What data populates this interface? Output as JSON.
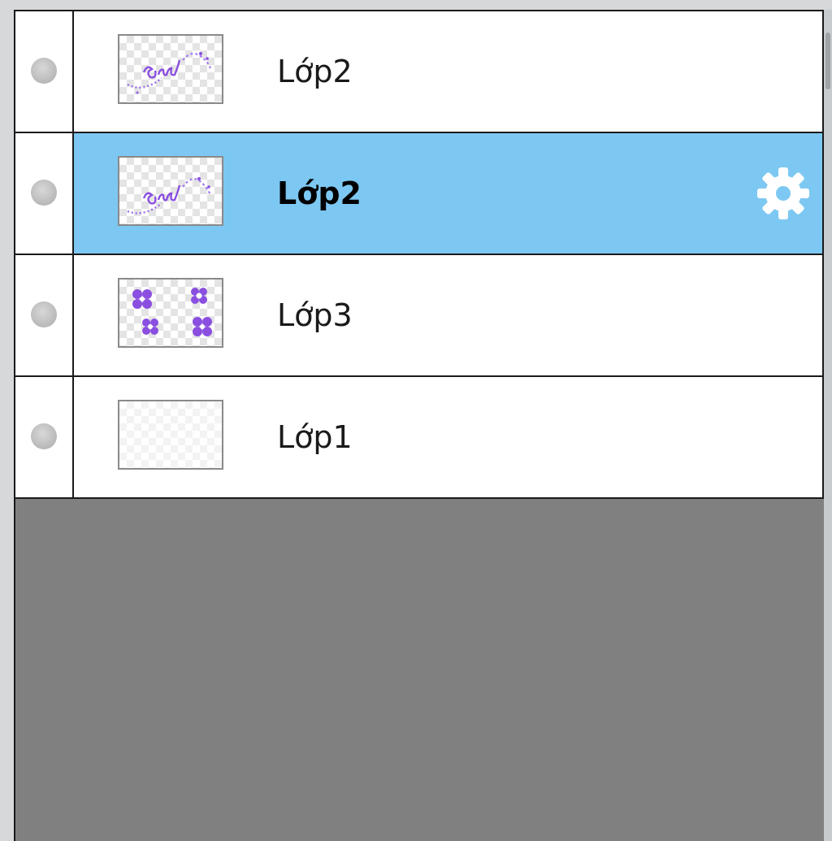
{
  "layers_panel": {
    "layers": [
      {
        "name": "Lớp2",
        "selected": false,
        "thumbnail": "purple-script-drawing",
        "visibility_icon": "circle-dot-icon"
      },
      {
        "name": "Lớp2",
        "selected": true,
        "thumbnail": "purple-script-drawing",
        "visibility_icon": "circle-dot-icon",
        "settings_icon": "gear-icon"
      },
      {
        "name": "Lớp3",
        "selected": false,
        "thumbnail": "purple-flowers-drawing",
        "visibility_icon": "circle-dot-icon"
      },
      {
        "name": "Lớp1",
        "selected": false,
        "thumbnail": "blank-layer",
        "visibility_icon": "circle-dot-icon"
      }
    ]
  },
  "colors": {
    "selected_row": "#7dc8f2",
    "empty_area": "#808080",
    "panel_background": "#d6d8da",
    "drawing_purple": "#8a4fe0"
  }
}
